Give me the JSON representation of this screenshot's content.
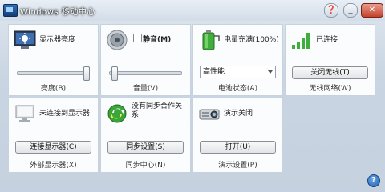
{
  "window": {
    "title": "Windows 移动中心"
  },
  "titlebar": {
    "help_glyph": "❓",
    "minimize_glyph": "_",
    "close_glyph": "✕"
  },
  "tiles": [
    {
      "id": "brightness",
      "caption": "亮度(B)",
      "label": "显示器亮度",
      "slider_value": 1.0
    },
    {
      "id": "volume",
      "caption": "音量(V)",
      "label": "静音(M)",
      "checkbox_checked": false,
      "slider_value": 0.0
    },
    {
      "id": "battery",
      "caption": "电池状态(A)",
      "label": "电量充满(100%)",
      "dropdown_value": "高性能"
    },
    {
      "id": "wireless",
      "caption": "无线网络(W)",
      "label": "已连接",
      "button_label": "关闭无线(T)"
    },
    {
      "id": "external_display",
      "caption": "外部显示器(X)",
      "label": "未连接到显示器",
      "button_label": "连接显示器(C)"
    },
    {
      "id": "sync",
      "caption": "同步中心(N)",
      "label": "没有同步合作关系",
      "button_label": "同步设置(S)"
    },
    {
      "id": "presentation",
      "caption": "演示设置(P)",
      "label": "演示关闭",
      "button_label": "打开(U)"
    }
  ],
  "help_button": {
    "glyph": "?"
  }
}
